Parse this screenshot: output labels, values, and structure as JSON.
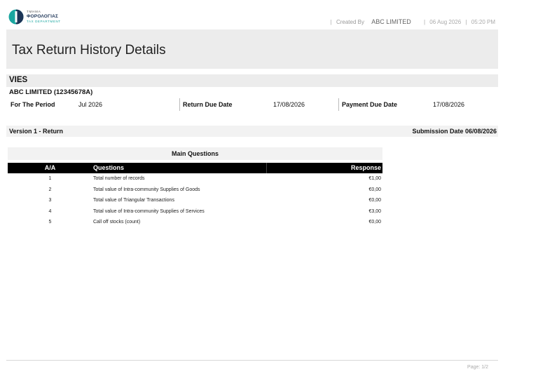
{
  "logo": {
    "line1": "ΤΜΗΜΑ",
    "line2": "ΦΟΡΟΛΟΓΙΑΣ",
    "line3": "TAX DEPARTMENT",
    "colors": {
      "teal": "#1aa6a0",
      "navy": "#1d3557"
    }
  },
  "meta": {
    "sep": "|",
    "created_by_label": "Created By",
    "company": "ABC LIMITED",
    "date": "06 Aug 2026",
    "time": "05:20 PM"
  },
  "title": "Tax Return History Details",
  "section": "VIES",
  "company_line": "ABC LIMITED (12345678A)",
  "period": {
    "period_label": "For The Period",
    "period_value": "Jul 2026",
    "return_due_label": "Return Due Date",
    "return_due_value": "17/08/2026",
    "payment_due_label": "Payment Due Date",
    "payment_due_value": "17/08/2026"
  },
  "version": {
    "label": "Version 1 - Return",
    "submission": "Submission Date 06/08/2026"
  },
  "main_questions": {
    "title": "Main Questions",
    "headers": {
      "aa": "A/A",
      "question": "Questions",
      "response": "Response"
    },
    "rows": [
      {
        "aa": "1",
        "question": "Total number of records",
        "response": "€1,00"
      },
      {
        "aa": "2",
        "question": "Total value of Intra-community Supplies of Goods",
        "response": "€0,00"
      },
      {
        "aa": "3",
        "question": "Total value of Triangular Transactions",
        "response": "€0,00"
      },
      {
        "aa": "4",
        "question": "Total value of Intra-community Supplies of Services",
        "response": "€3,00"
      },
      {
        "aa": "5",
        "question": "Call off stocks (count)",
        "response": "€0,00"
      }
    ]
  },
  "footer": {
    "page": "Page: 1/2"
  }
}
